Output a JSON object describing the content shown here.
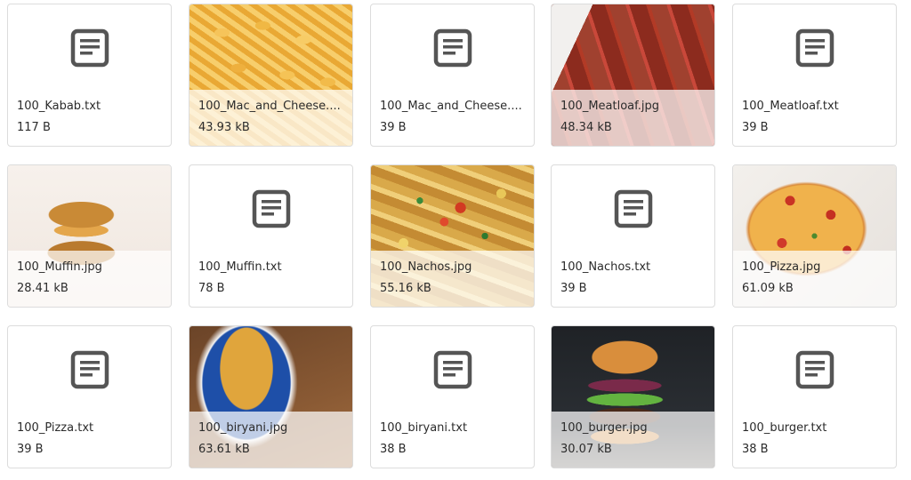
{
  "icons": {
    "text_file": "text-file-icon",
    "icon_color": "#555555"
  },
  "files": [
    {
      "name": "100_Kabab.txt",
      "size": "117 B",
      "kind": "text"
    },
    {
      "name": "100_Mac_and_Cheese....",
      "size": "43.93 kB",
      "kind": "image",
      "thumb": "food-mac"
    },
    {
      "name": "100_Mac_and_Cheese....",
      "size": "39 B",
      "kind": "text"
    },
    {
      "name": "100_Meatloaf.jpg",
      "size": "48.34 kB",
      "kind": "image",
      "thumb": "food-meatloaf"
    },
    {
      "name": "100_Meatloaf.txt",
      "size": "39 B",
      "kind": "text"
    },
    {
      "name": "100_Muffin.jpg",
      "size": "28.41 kB",
      "kind": "image",
      "thumb": "food-muffin"
    },
    {
      "name": "100_Muffin.txt",
      "size": "78 B",
      "kind": "text"
    },
    {
      "name": "100_Nachos.jpg",
      "size": "55.16 kB",
      "kind": "image",
      "thumb": "food-nachos"
    },
    {
      "name": "100_Nachos.txt",
      "size": "39 B",
      "kind": "text"
    },
    {
      "name": "100_Pizza.jpg",
      "size": "61.09 kB",
      "kind": "image",
      "thumb": "food-pizza"
    },
    {
      "name": "100_Pizza.txt",
      "size": "39 B",
      "kind": "text"
    },
    {
      "name": "100_biryani.jpg",
      "size": "63.61 kB",
      "kind": "image",
      "thumb": "food-biryani"
    },
    {
      "name": "100_biryani.txt",
      "size": "38 B",
      "kind": "text"
    },
    {
      "name": "100_burger.jpg",
      "size": "30.07 kB",
      "kind": "image",
      "thumb": "food-burger"
    },
    {
      "name": "100_burger.txt",
      "size": "38 B",
      "kind": "text"
    }
  ]
}
